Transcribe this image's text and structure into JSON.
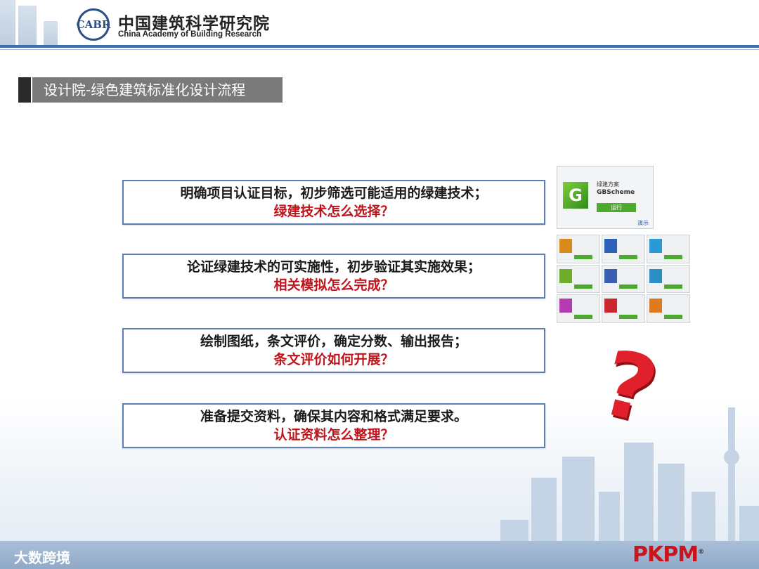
{
  "header": {
    "org_name_cn": "中国建筑科学研究院",
    "org_name_en": "China Academy of Building Research"
  },
  "slide": {
    "title": "设计院-绿色建筑标准化设计流程"
  },
  "steps": [
    {
      "text": "明确项目认证目标，初步筛选可能适用的绿建技术；",
      "question": "绿建技术怎么选择？"
    },
    {
      "text": "论证绿建技术的可实施性，初步验证其实施效果；",
      "question": "相关模拟怎么完成？"
    },
    {
      "text": "绘制图纸，条文评价，确定分数、输出报告；",
      "question": "条文评价如何开展？"
    },
    {
      "text": "准备提交资料，确保其内容和格式满足要求。",
      "question": "认证资料怎么整理？"
    }
  ],
  "software": {
    "logo_letter": "G",
    "name_cn": "绿建方案",
    "name_en": "GBScheme",
    "run_label": "运行",
    "demo_label": "演示",
    "module_colors": [
      "#d98a1c",
      "#2c5fb8",
      "#2a9ad6",
      "#6fae2c",
      "#3b5fb0",
      "#2a8fc4",
      "#b53bb0",
      "#c8282e",
      "#e07a1e"
    ]
  },
  "question_mark": "?",
  "footer": {
    "watermark": "大数跨境",
    "brand": "PKPM",
    "registered": "®"
  }
}
